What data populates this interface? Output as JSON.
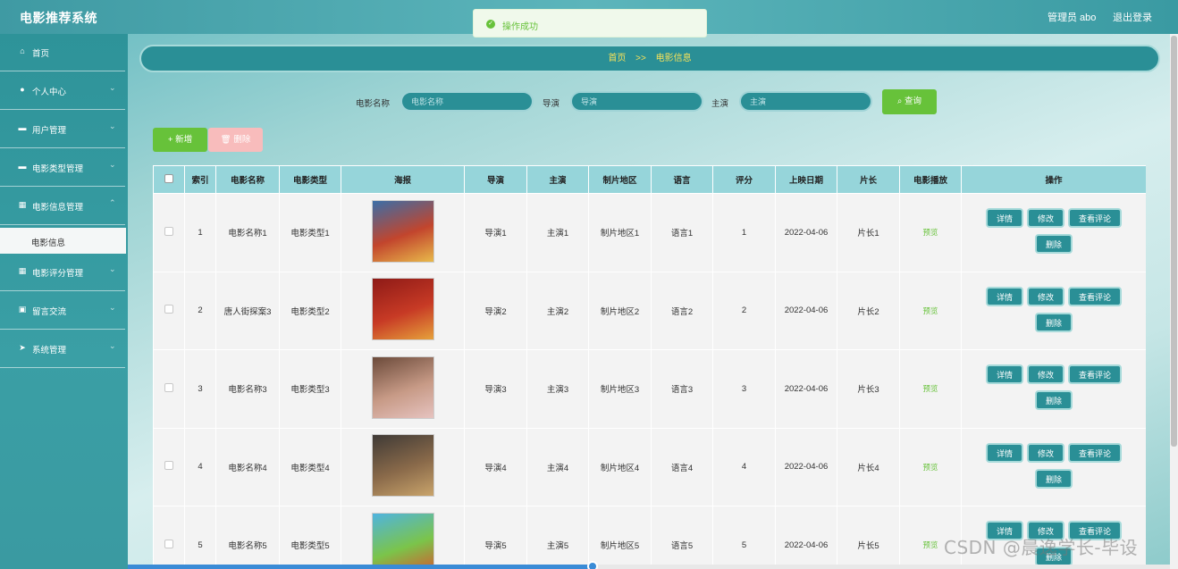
{
  "app": {
    "title": "电影推荐系统",
    "user": "管理员 abo",
    "logout": "退出登录"
  },
  "toast": {
    "message": "操作成功"
  },
  "sidebar": {
    "items": [
      {
        "label": "首页",
        "icon": "home-icon",
        "glyph": "⌂"
      },
      {
        "label": "个人中心",
        "icon": "user-icon",
        "glyph": "●"
      },
      {
        "label": "用户管理",
        "icon": "monitor-icon",
        "glyph": "▬"
      },
      {
        "label": "电影类型管理",
        "icon": "chat-icon",
        "glyph": "▬"
      },
      {
        "label": "电影信息管理",
        "icon": "grid-icon",
        "glyph": "▦"
      },
      {
        "label": "电影评分管理",
        "icon": "grid-icon",
        "glyph": "▦"
      },
      {
        "label": "留言交流",
        "icon": "clipboard-icon",
        "glyph": "▣"
      },
      {
        "label": "系统管理",
        "icon": "send-icon",
        "glyph": "➤"
      }
    ],
    "active_sub": "电影信息"
  },
  "breadcrumb": {
    "home": "首页",
    "sep": ">>",
    "current": "电影信息"
  },
  "search": {
    "name_label": "电影名称",
    "name_placeholder": "电影名称",
    "director_label": "导演",
    "director_placeholder": "导演",
    "actor_label": "主演",
    "actor_placeholder": "主演",
    "query_btn": "查询"
  },
  "actions": {
    "add": "新增",
    "delete": "删除"
  },
  "table": {
    "headers": [
      "索引",
      "电影名称",
      "电影类型",
      "海报",
      "导演",
      "主演",
      "制片地区",
      "语言",
      "评分",
      "上映日期",
      "片长",
      "电影播放",
      "操作"
    ],
    "row_buttons": {
      "detail": "详情",
      "edit": "修改",
      "comments": "查看评论",
      "delete": "删除"
    },
    "preview_label": "预览",
    "rows": [
      {
        "index": "1",
        "name": "电影名称1",
        "type": "电影类型1",
        "director": "导演1",
        "actor": "主演1",
        "region": "制片地区1",
        "language": "语言1",
        "score": "1",
        "date": "2022-04-06",
        "length": "片长1",
        "poster_colors": [
          "#3a6ea8",
          "#c2452d",
          "#e8b94a"
        ]
      },
      {
        "index": "2",
        "name": "唐人街探案3",
        "type": "电影类型2",
        "director": "导演2",
        "actor": "主演2",
        "region": "制片地区2",
        "language": "语言2",
        "score": "2",
        "date": "2022-04-06",
        "length": "片长2",
        "poster_colors": [
          "#8e1a17",
          "#c73a25",
          "#e6a13b"
        ]
      },
      {
        "index": "3",
        "name": "电影名称3",
        "type": "电影类型3",
        "director": "导演3",
        "actor": "主演3",
        "region": "制片地区3",
        "language": "语言3",
        "score": "3",
        "date": "2022-04-06",
        "length": "片长3",
        "poster_colors": [
          "#6b4a3a",
          "#c79a86",
          "#e6c3c0"
        ]
      },
      {
        "index": "4",
        "name": "电影名称4",
        "type": "电影类型4",
        "director": "导演4",
        "actor": "主演4",
        "region": "制片地区4",
        "language": "语言4",
        "score": "4",
        "date": "2022-04-06",
        "length": "片长4",
        "poster_colors": [
          "#3f3a36",
          "#8a6a4a",
          "#c9a46b"
        ]
      },
      {
        "index": "5",
        "name": "电影名称5",
        "type": "电影类型5",
        "director": "导演5",
        "actor": "主演5",
        "region": "制片地区5",
        "language": "语言5",
        "score": "5",
        "date": "2022-04-06",
        "length": "片长5",
        "poster_colors": [
          "#4fb4e0",
          "#7bc44a",
          "#d9552e"
        ]
      }
    ]
  },
  "watermark": "CSDN @晨逸学长-毕设",
  "colors": {
    "teal": "#2a8f96",
    "green": "#67c23a",
    "header": "#96d5da"
  }
}
